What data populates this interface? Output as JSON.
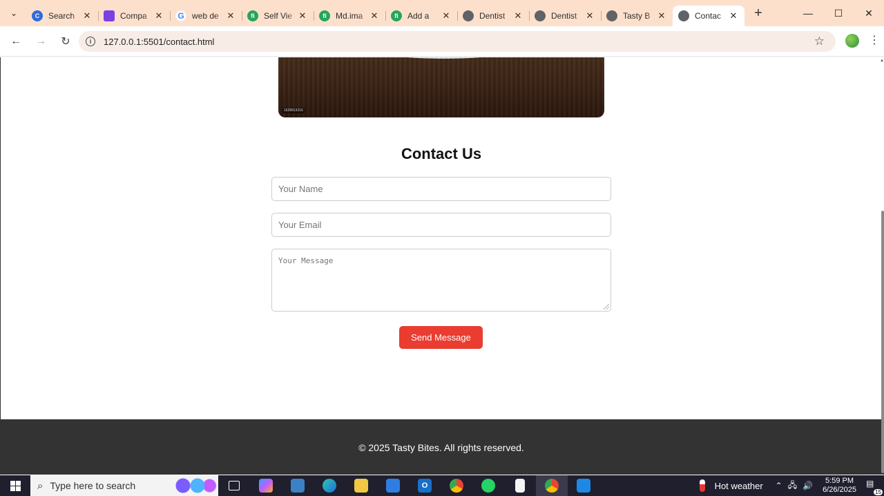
{
  "browser": {
    "tabs": [
      {
        "title": "Search",
        "favicon": "copilot-c",
        "active": false
      },
      {
        "title": "Compa",
        "favicon": "calendar",
        "active": false
      },
      {
        "title": "web de",
        "favicon": "google-g",
        "active": false
      },
      {
        "title": "Self Vie",
        "favicon": "fiverr-fi",
        "active": false
      },
      {
        "title": "Md.ima",
        "favicon": "fiverr-fi",
        "active": false
      },
      {
        "title": "Add a",
        "favicon": "fiverr-fi",
        "active": false
      },
      {
        "title": "Dentist",
        "favicon": "globe",
        "active": false
      },
      {
        "title": "Dentist",
        "favicon": "globe",
        "active": false
      },
      {
        "title": "Tasty B",
        "favicon": "globe",
        "active": false
      },
      {
        "title": "Contac",
        "favicon": "globe",
        "active": true
      }
    ],
    "url": "127.0.0.1:5501/contact.html",
    "icons": {
      "back": "←",
      "forward": "→",
      "reload": "↻",
      "star": "☆",
      "kebab": "⋮",
      "new_tab": "+",
      "minimize": "—",
      "maximize": "☐",
      "close": "✕",
      "tab_close": "✕",
      "tab_menu": "⌄"
    }
  },
  "page": {
    "hero_stamp": "1628913216",
    "contact": {
      "title": "Contact Us",
      "name_placeholder": "Your Name",
      "email_placeholder": "Your Email",
      "message_placeholder": "Your Message",
      "send_label": "Send Message"
    },
    "footer": {
      "text": "© 2025 Tasty Bites. All rights reserved."
    },
    "colors": {
      "button": "#ea3c31",
      "footer_bg": "#333333",
      "tab_strip": "#fde0cc"
    }
  },
  "taskbar": {
    "search_placeholder": "Type here to search",
    "apps": [
      "task-view",
      "copilot",
      "app-store-box",
      "edge",
      "file-explorer",
      "microsoft-store",
      "outlook",
      "chrome",
      "whatsapp",
      "notepad",
      "chrome-profile",
      "vscode"
    ],
    "weather": "Hot weather",
    "time": "5:59 PM",
    "date": "6/26/2025",
    "notifications": "15"
  }
}
